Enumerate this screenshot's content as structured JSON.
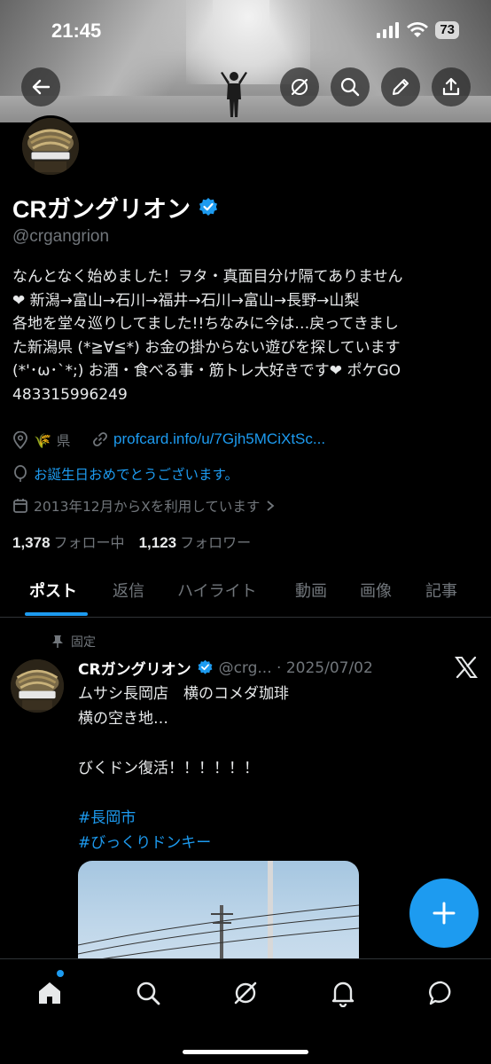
{
  "status_bar": {
    "time": "21:45",
    "battery": "73"
  },
  "profile": {
    "name": "CRガングリオン",
    "handle": "@crgangrion",
    "bio_lines": [
      "なんとなく始めました！ヲタ・真面目分け隔てありません",
      "❤ 新潟→富山→石川→福井→石川→富山→長野→山梨",
      "各地を堂々巡りしてました!!ちなみに今は…戻ってきまし",
      "た新潟県 (*≧∀≦*) お金の掛からない遊びを探しています",
      "(*'･ω･`*;) お酒・食べる事・筋トレ大好きです❤ ポケGO",
      "483315996249"
    ],
    "location_emoji": "🌾",
    "location_suffix": "県",
    "link": "profcard.info/u/7Gjh5MCiXtSc...",
    "birthday": "お誕生日おめでとうございます。",
    "joined": "2013年12月からXを利用しています",
    "following_count": "1,378",
    "following_label": "フォロー中",
    "followers_count": "1,123",
    "followers_label": "フォロワー"
  },
  "tabs": [
    "ポスト",
    "返信",
    "ハイライト",
    "動画",
    "画像",
    "記事"
  ],
  "pinned_post": {
    "pinned_label": "固定",
    "author": "CRガングリオン",
    "handle_date": "@crg... · 2025/07/02",
    "lines": [
      "ムサシ長岡店　横のコメダ珈琲",
      "横の空き地…",
      "",
      "びくドン復活！！！！！！"
    ],
    "hashtags": [
      "#長岡市",
      "#びっくりドンキー"
    ]
  },
  "colors": {
    "accent": "#1d9bf0",
    "background": "#000000",
    "muted": "#71767b"
  },
  "icons": [
    "back-arrow-icon",
    "grok-icon",
    "search-icon",
    "edit-icon",
    "share-icon",
    "location-icon",
    "link-icon",
    "balloon-icon",
    "calendar-icon",
    "pin-icon",
    "verified-icon",
    "x-logo-icon",
    "plus-icon",
    "home-icon",
    "search-icon",
    "grok-icon",
    "bell-icon",
    "message-icon"
  ]
}
